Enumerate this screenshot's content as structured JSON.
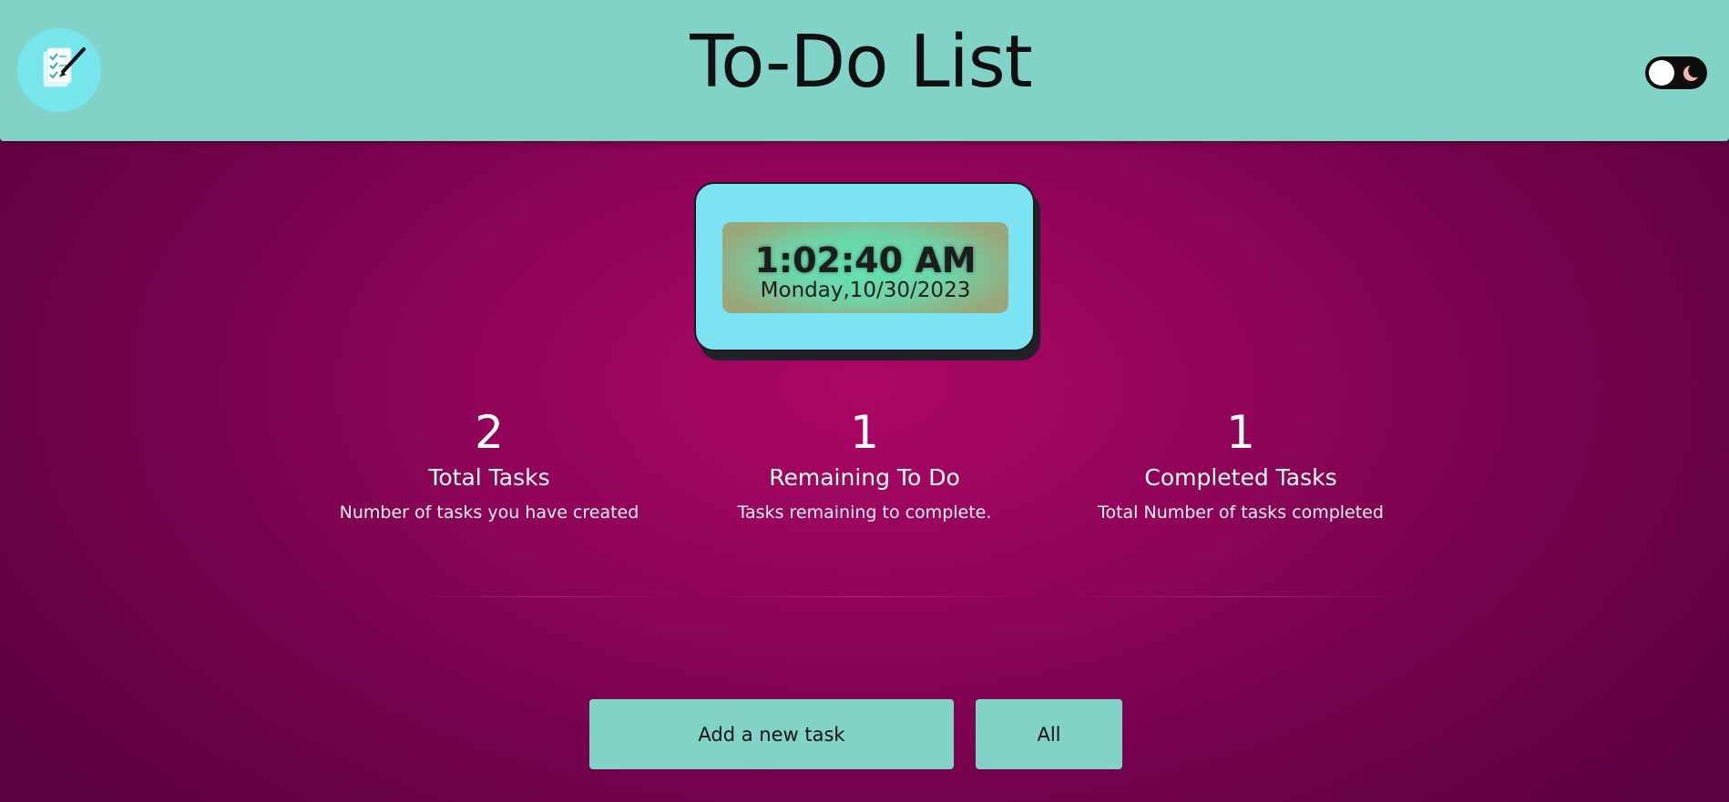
{
  "header": {
    "title": "To-Do List",
    "logo_icon": "checklist-pencil-icon",
    "theme_toggle": {
      "state": "light",
      "icon": "moon-icon"
    }
  },
  "clock": {
    "time": "1:02:40 AM",
    "date": "Monday,10/30/2023"
  },
  "stats": [
    {
      "value": "2",
      "title": "Total Tasks",
      "description": "Number of tasks you have created"
    },
    {
      "value": "1",
      "title": "Remaining To Do",
      "description": "Tasks remaining to complete."
    },
    {
      "value": "1",
      "title": "Completed Tasks",
      "description": "Total Number of tasks completed"
    }
  ],
  "actions": {
    "add_task_label": "Add a new task",
    "filter_label": "All"
  },
  "colors": {
    "header_bg": "#81d3c8",
    "page_bg": "#8f0459",
    "clock_card_bg": "#7be3f2",
    "clock_face_bg": "#62e3b0",
    "button_bg": "#81d3c8"
  }
}
